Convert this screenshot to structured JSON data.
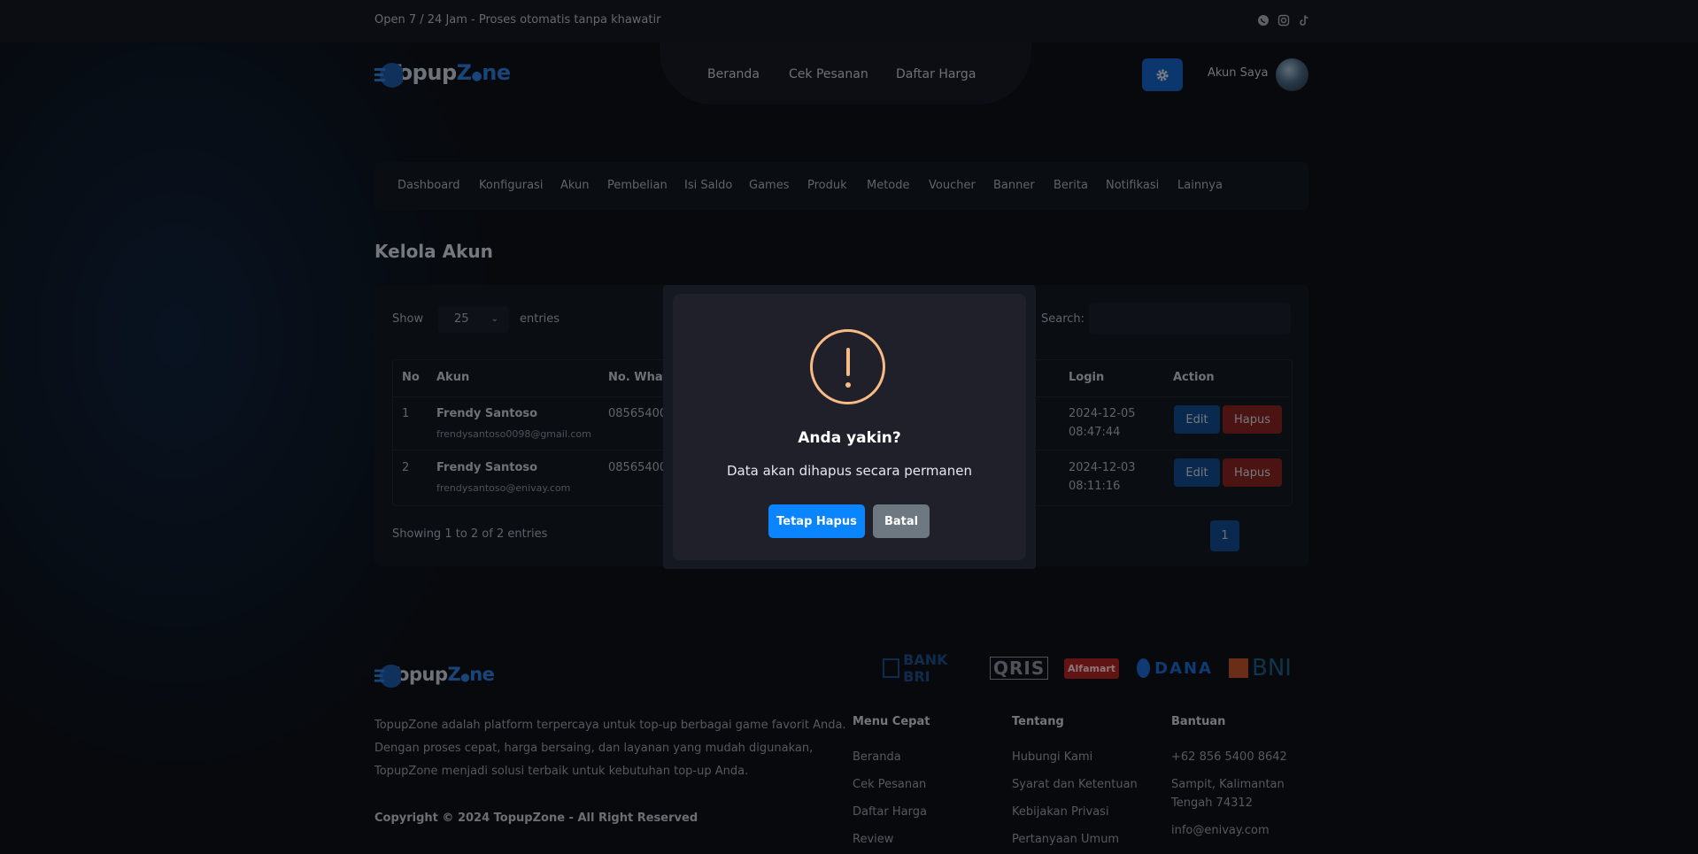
{
  "topbar": {
    "tagline": "Open 7 / 24 Jam - Proses otomatis tanpa khawatir",
    "social_icons": [
      "whatsapp-icon",
      "instagram-icon",
      "tiktok-icon"
    ]
  },
  "brand": {
    "name_part1": "Topup",
    "name_part2": "Z",
    "name_part3": "ne",
    "accent": "#2f7fe0"
  },
  "nav": {
    "items": [
      "Beranda",
      "Cek Pesanan",
      "Daftar Harga"
    ],
    "account_label": "Akun Saya"
  },
  "admin_menu": {
    "items": [
      "Dashboard",
      "Konfigurasi",
      "Akun",
      "Pembelian",
      "Isi Saldo",
      "Games",
      "Produk",
      "Metode",
      "Voucher",
      "Banner",
      "Berita",
      "Notifikasi",
      "Lainnya"
    ]
  },
  "page": {
    "title": "Kelola Akun"
  },
  "table_controls": {
    "show_label": "Show",
    "entries_value": "25",
    "entries_label": "entries",
    "search_label": "Search:"
  },
  "table": {
    "headers": [
      "No",
      "Akun",
      "No. Whatsapp",
      "Login",
      "Action"
    ],
    "rows": [
      {
        "no": "1",
        "name": "Frendy Santoso",
        "email": "frendysantoso0098@gmail.com",
        "whatsapp": "085654008",
        "login_date": "2024-12-05",
        "login_time": "08:47:44"
      },
      {
        "no": "2",
        "name": "Frendy Santoso",
        "email": "frendysantoso@enivay.com",
        "whatsapp": "085654008",
        "login_date": "2024-12-03",
        "login_time": "08:11:16"
      }
    ],
    "edit_label": "Edit",
    "delete_label": "Hapus",
    "footer_info": "Showing 1 to 2 of 2 entries",
    "current_page": "1"
  },
  "modal": {
    "title": "Anda yakin?",
    "text": "Data akan dihapus secara permanen",
    "confirm_label": "Tetap Hapus",
    "cancel_label": "Batal",
    "confirm_color": "#0a84ff",
    "cancel_color": "#6e7881",
    "icon": "warning-icon",
    "icon_color": "#f8bb86"
  },
  "footer": {
    "description": [
      "TopupZone adalah platform terpercaya untuk top-up berbagai game favorit Anda.",
      "Dengan proses cepat, harga bersaing, dan layanan yang mudah digunakan,",
      "TopupZone menjadi solusi terbaik untuk kebutuhan top-up Anda."
    ],
    "copyright": "Copyright © 2024 TopupZone - All Right Reserved",
    "menu_cepat": {
      "title": "Menu Cepat",
      "links": [
        "Beranda",
        "Cek Pesanan",
        "Daftar Harga",
        "Review"
      ]
    },
    "tentang": {
      "title": "Tentang",
      "links": [
        "Hubungi Kami",
        "Syarat dan Ketentuan",
        "Kebijakan Privasi",
        "Pertanyaan Umum"
      ]
    },
    "bantuan": {
      "title": "Bantuan",
      "phone": "+62 856 5400 8642",
      "address_line1": "Sampit, Kalimantan",
      "address_line2": "Tengah 74312",
      "email": "info@enivay.com"
    },
    "payments": [
      "BANK BRI",
      "QRIS",
      "Alfamart",
      "DANA",
      "BNI"
    ]
  }
}
